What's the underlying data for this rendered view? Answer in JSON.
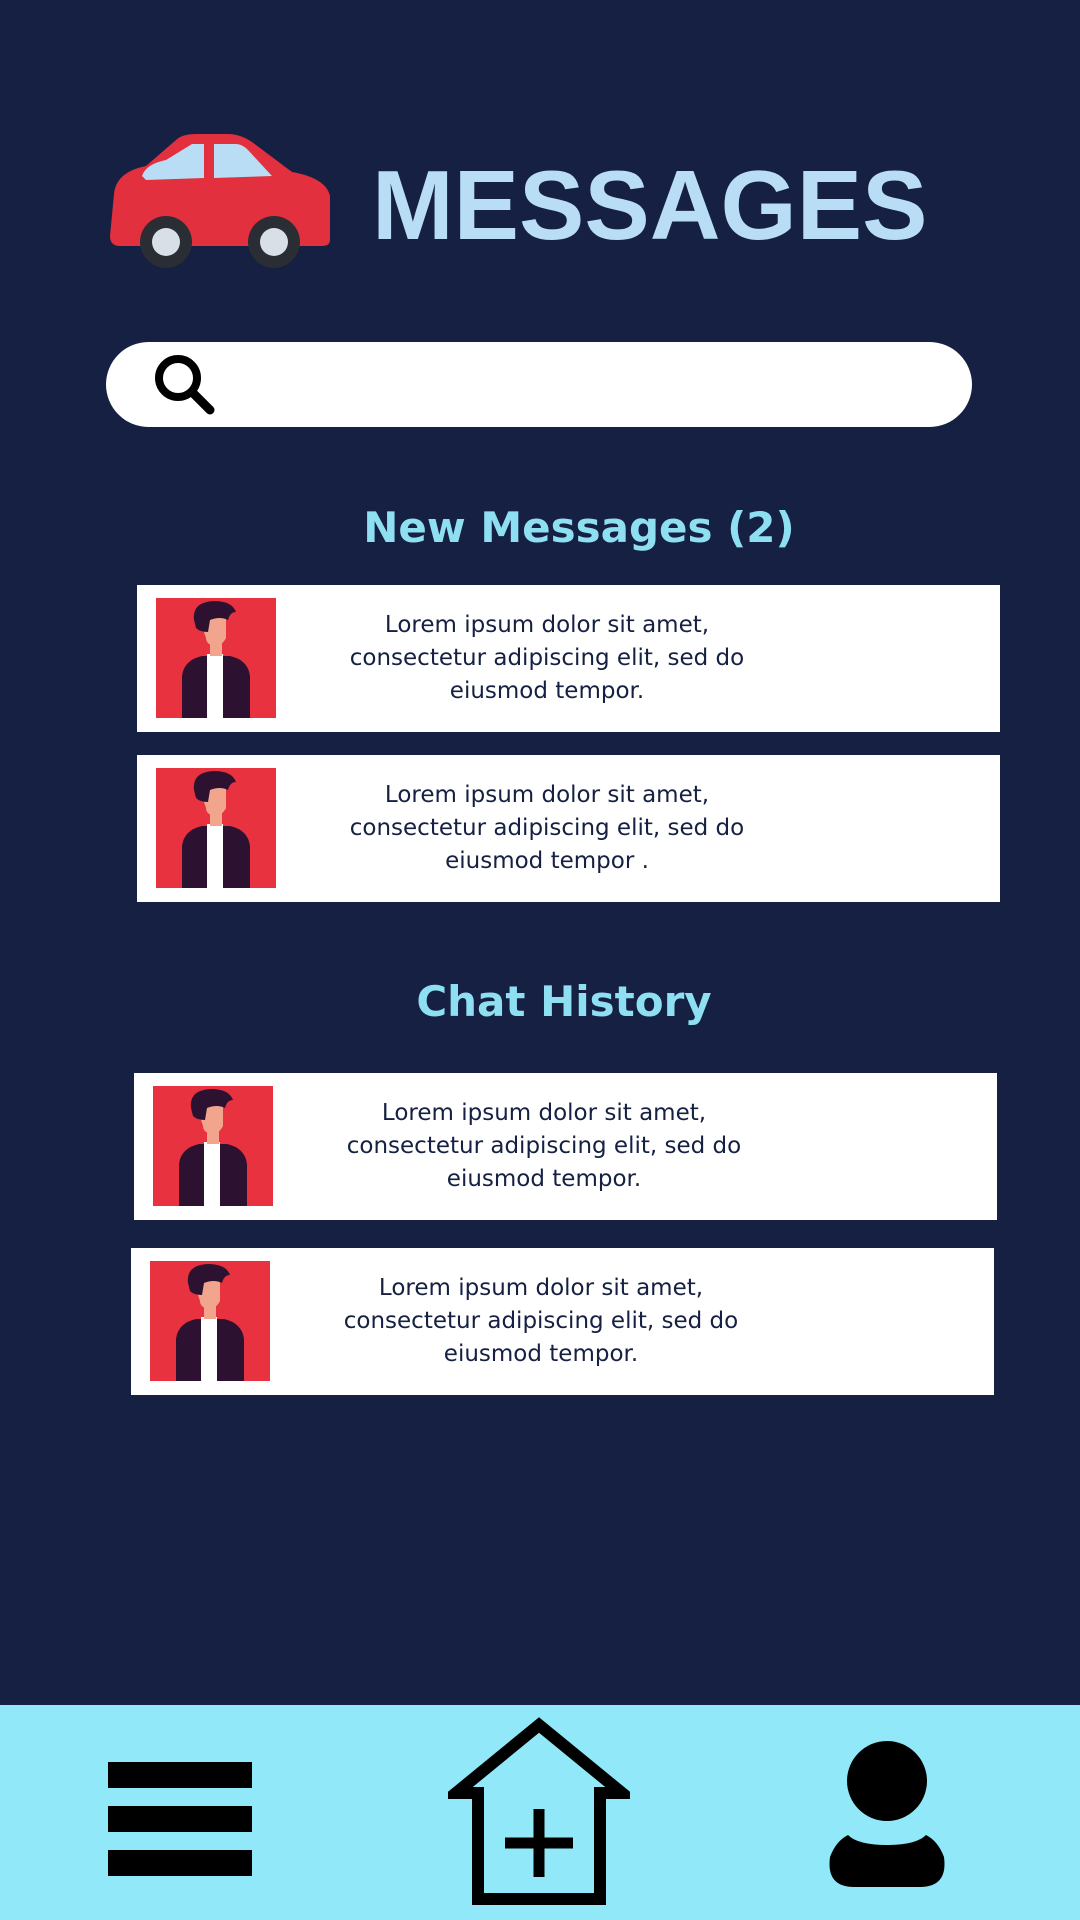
{
  "header": {
    "title": "MESSAGES",
    "logo_icon": "car-icon"
  },
  "search": {
    "placeholder": "",
    "value": "",
    "icon": "search-icon"
  },
  "sections": {
    "new_messages": {
      "heading": "New Messages (2)",
      "items": [
        {
          "text": "Lorem ipsum dolor sit amet, consectetur adipiscing elit, sed do eiusmod tempor.",
          "avatar_icon": "person-avatar-icon"
        },
        {
          "text": "Lorem ipsum dolor sit amet, consectetur adipiscing elit, sed do eiusmod tempor .",
          "avatar_icon": "person-avatar-icon"
        }
      ]
    },
    "chat_history": {
      "heading": "Chat History",
      "items": [
        {
          "text": "Lorem ipsum dolor sit amet, consectetur adipiscing elit, sed do eiusmod tempor.",
          "avatar_icon": "person-avatar-icon"
        },
        {
          "text": "Lorem ipsum dolor sit amet, consectetur adipiscing elit, sed do eiusmod tempor.",
          "avatar_icon": "person-avatar-icon"
        }
      ]
    }
  },
  "bottom_nav": {
    "items": [
      {
        "icon": "hamburger-menu-icon"
      },
      {
        "icon": "home-add-icon"
      },
      {
        "icon": "user-profile-icon"
      }
    ]
  },
  "colors": {
    "background": "#152042",
    "title": "#b9ddf5",
    "section_heading": "#8fdff2",
    "card_background": "#ffffff",
    "card_text": "#152042",
    "avatar_background": "#e8323f",
    "nav_background": "#91e8f8",
    "car_body": "#e2303f",
    "icon_dark": "#000000"
  }
}
